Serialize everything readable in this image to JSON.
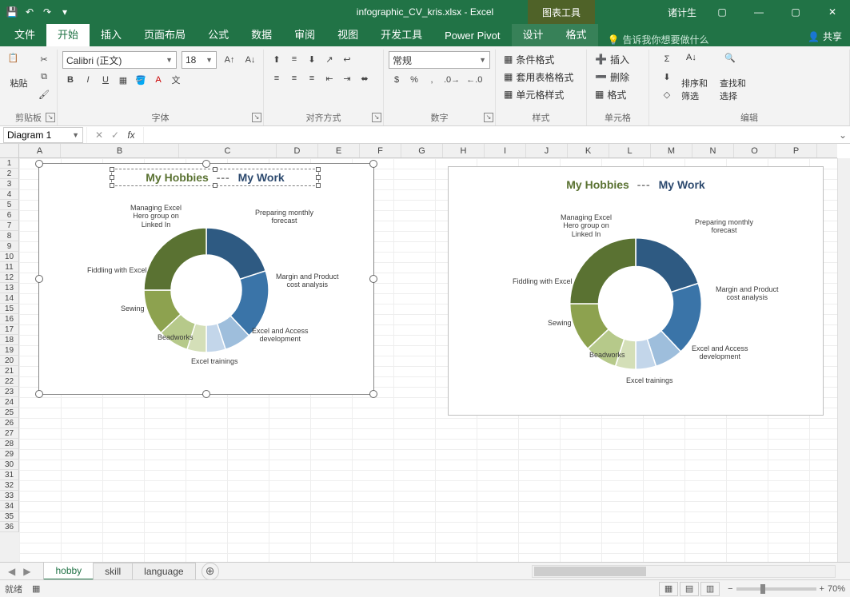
{
  "app": {
    "title_file": "infographic_CV_kris.xlsx - Excel",
    "chart_tools": "图表工具",
    "user": "诸计生"
  },
  "qat": {
    "save": "💾",
    "undo": "↶",
    "redo": "↷",
    "more": "▾"
  },
  "tabs": {
    "file": "文件",
    "home": "开始",
    "insert": "插入",
    "layout": "页面布局",
    "formulas": "公式",
    "data": "数据",
    "review": "审阅",
    "view": "视图",
    "dev": "开发工具",
    "pp": "Power Pivot",
    "design": "设计",
    "format": "格式",
    "tellme": "告诉我你想要做什么",
    "share": "共享"
  },
  "ribbon": {
    "clipboard": {
      "label": "剪贴板",
      "paste": "粘贴"
    },
    "font": {
      "label": "字体",
      "name": "Calibri (正文)",
      "size": "18",
      "bold": "B",
      "italic": "I",
      "underline": "U"
    },
    "align": {
      "label": "对齐方式",
      "wen": "文"
    },
    "number": {
      "label": "数字",
      "format": "常规"
    },
    "styles": {
      "label": "样式",
      "cond": "条件格式",
      "tbl": "套用表格格式",
      "cell": "单元格样式"
    },
    "cells": {
      "label": "单元格",
      "ins": "插入",
      "del": "删除",
      "fmt": "格式"
    },
    "editing": {
      "label": "编辑",
      "sort": "排序和筛选",
      "find": "查找和选择"
    }
  },
  "namebox": "Diagram 1",
  "sheets": {
    "s1": "hobby",
    "s2": "skill",
    "s3": "language"
  },
  "status": {
    "ready": "就绪",
    "zoom": "70%"
  },
  "chart": {
    "title_hobbies": "My Hobbies",
    "title_sep": "---",
    "title_work": "My Work",
    "labels": {
      "manage": "Managing Excel\nHero group on\nLinked In",
      "fiddle": "Fiddling with Excel",
      "sew": "Sewing",
      "bead": "Beadworks",
      "train": "Excel trainings",
      "forecast": "Preparing monthly\nforecast",
      "margin": "Margin and Product\ncost analysis",
      "dev": "Excel and Access\ndevelopment"
    }
  },
  "chart_data": {
    "type": "pie",
    "title": "My Hobbies --- My Work",
    "series": [
      {
        "name": "My Work",
        "color_theme": "blue",
        "slices": [
          {
            "label": "Preparing monthly forecast",
            "value": 20,
            "color": "#2e5a82"
          },
          {
            "label": "Margin and Product cost analysis",
            "value": 18,
            "color": "#3a74a8"
          },
          {
            "label": "Excel and Access development",
            "value": 7,
            "color": "#9ebedc"
          },
          {
            "label": "Excel trainings",
            "value": 5,
            "color": "#c3d6ea"
          }
        ]
      },
      {
        "name": "My Hobbies",
        "color_theme": "green",
        "slices": [
          {
            "label": "Beadworks",
            "value": 5,
            "color": "#d4dfb8"
          },
          {
            "label": "Sewing",
            "value": 8,
            "color": "#b6c98a"
          },
          {
            "label": "Fiddling with Excel",
            "value": 12,
            "color": "#8da24f"
          },
          {
            "label": "Managing Excel Hero group on Linked In",
            "value": 25,
            "color": "#5a7232"
          }
        ]
      }
    ],
    "inner_radius_pct": 55
  }
}
